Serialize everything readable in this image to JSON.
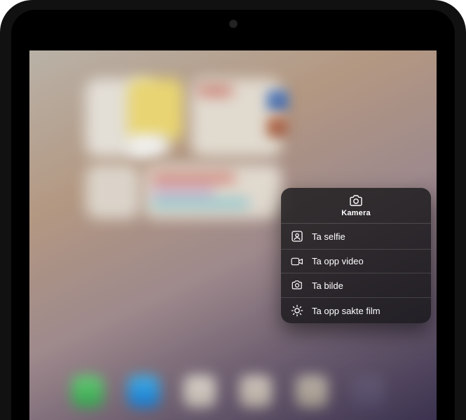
{
  "menu": {
    "title": "Kamera",
    "items": [
      {
        "icon": "selfie-icon",
        "label": "Ta selfie"
      },
      {
        "icon": "video-icon",
        "label": "Ta opp video"
      },
      {
        "icon": "photo-icon",
        "label": "Ta bilde"
      },
      {
        "icon": "slowmo-icon",
        "label": "Ta opp sakte film"
      }
    ]
  }
}
